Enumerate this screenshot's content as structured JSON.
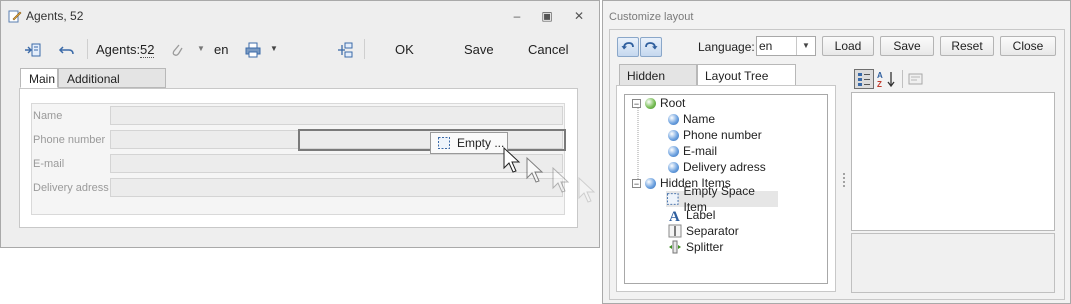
{
  "agents_window": {
    "title": "Agents, 52",
    "toolbar": {
      "agents_label": "Agents:",
      "agents_count": "52",
      "language_value": "en",
      "ok_label": "OK",
      "save_label": "Save",
      "cancel_label": "Cancel"
    },
    "tabs": [
      {
        "label": "Main",
        "active": true
      },
      {
        "label": "Additional adresses",
        "active": false
      }
    ],
    "fields": [
      {
        "label": "Name",
        "value": ""
      },
      {
        "label": "Phone number",
        "value": ""
      },
      {
        "label": "E-mail",
        "value": ""
      },
      {
        "label": "Delivery adress",
        "value": ""
      }
    ],
    "drag_chip_label": "Empty ..."
  },
  "customize_window": {
    "title": "Customize layout",
    "language_label": "Language:",
    "language_value": "en",
    "buttons": {
      "load": "Load",
      "save": "Save",
      "reset": "Reset",
      "close": "Close"
    },
    "tabs": [
      {
        "label": "Hidden Items",
        "active": false
      },
      {
        "label": "Layout Tree View",
        "active": true
      }
    ],
    "tree": {
      "root_label": "Root",
      "root_children": [
        "Name",
        "Phone number",
        "E-mail",
        "Delivery adress"
      ],
      "hidden_label": "Hidden Items",
      "hidden_children": [
        {
          "label": "Empty Space Item",
          "icon": "empty-space-icon",
          "selected": true
        },
        {
          "label": "Label",
          "icon": "label-icon",
          "selected": false
        },
        {
          "label": "Separator",
          "icon": "separator-icon",
          "selected": false
        },
        {
          "label": "Splitter",
          "icon": "splitter-icon",
          "selected": false
        }
      ]
    }
  },
  "colors": {
    "accent_blue": "#3b6aa8",
    "sphere_blue": "#6fa3e0",
    "sphere_green": "#7cc05a"
  }
}
